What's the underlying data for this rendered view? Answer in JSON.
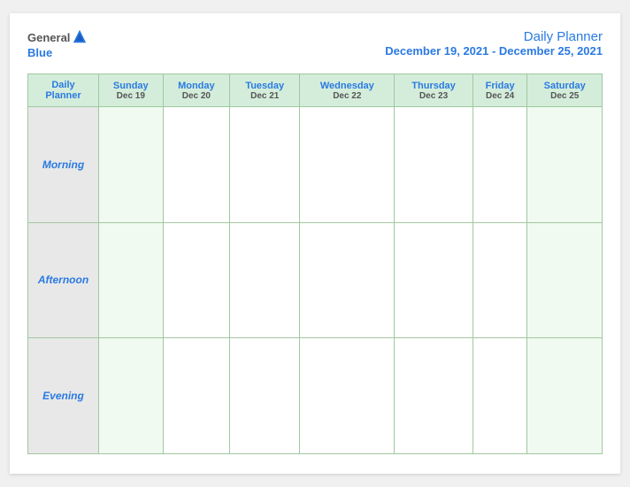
{
  "header": {
    "logo_general": "General",
    "logo_blue": "Blue",
    "title": "Daily Planner",
    "date_range": "December 19, 2021 - December 25, 2021"
  },
  "columns": [
    {
      "name": "Daily Planner",
      "date": ""
    },
    {
      "name": "Sunday",
      "date": "Dec 19"
    },
    {
      "name": "Monday",
      "date": "Dec 20"
    },
    {
      "name": "Tuesday",
      "date": "Dec 21"
    },
    {
      "name": "Wednesday",
      "date": "Dec 22"
    },
    {
      "name": "Thursday",
      "date": "Dec 23"
    },
    {
      "name": "Friday",
      "date": "Dec 24"
    },
    {
      "name": "Saturday",
      "date": "Dec 25"
    }
  ],
  "rows": [
    {
      "label": "Morning"
    },
    {
      "label": "Afternoon"
    },
    {
      "label": "Evening"
    }
  ]
}
